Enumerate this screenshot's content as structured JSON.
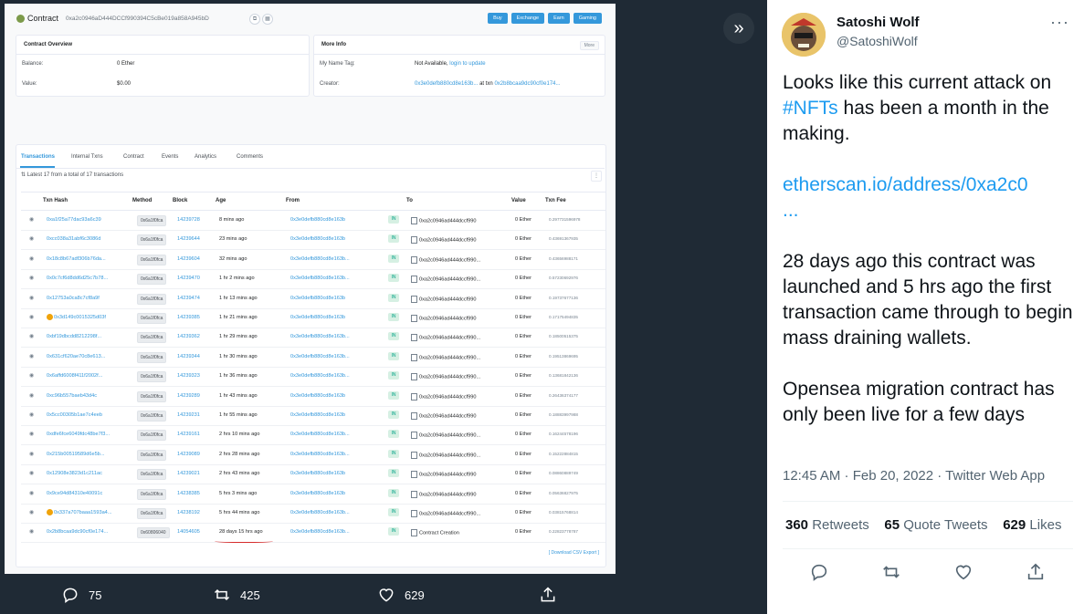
{
  "etherscan": {
    "title": "Contract",
    "address": "0xa2c0946aD444DCCf990394C5cBe019a858A945bD",
    "nav": [
      "Buy",
      "Exchange",
      "Earn",
      "Gaming"
    ],
    "overview": {
      "heading": "Contract Overview",
      "balance_label": "Balance:",
      "balance_value": "0 Ether",
      "value_label": "Value:",
      "value_value": "$0.00"
    },
    "more_info": {
      "heading": "More Info",
      "dropdown": "More",
      "tag_label": "My Name Tag:",
      "tag_value": "Not Available,",
      "tag_link": "login to update",
      "creator_label": "Creator:",
      "creator_addr": "0x3e0defb880cd8e163b...",
      "creator_at": "at txn",
      "creator_txn": "0x2b8bcaa9dc90cf0e174..."
    },
    "tabs": [
      "Transactions",
      "Internal Txns",
      "Contract",
      "Events",
      "Analytics",
      "Comments"
    ],
    "summary": "Latest 17 from a total of 17 transactions",
    "columns": [
      "Txn Hash",
      "Method",
      "Block",
      "Age",
      "From",
      "To",
      "Value",
      "Txn Fee"
    ],
    "rows": [
      {
        "hash": "0xa1f25a77dac93a6c39",
        "method": "0x6a1f0fca",
        "block": "14239728",
        "age": "8 mins ago",
        "from": "0x3e0defb880cd8e163b",
        "to": "0xa2c0946ad444dccf990",
        "value": "0 Ether",
        "fee": "0.297731596978",
        "warn": false
      },
      {
        "hash": "0xcc038a31abf6c3086d",
        "method": "0x6a1f0fca",
        "block": "14239644",
        "age": "23 mins ago",
        "from": "0x3e0defb880cd8e163b",
        "to": "0xa2c0946ad444dccf990",
        "value": "0 Ether",
        "fee": "0.43691367935",
        "warn": false
      },
      {
        "hash": "0x18c8b67adf306b76da...",
        "method": "0x6a1f0fca",
        "block": "14239604",
        "age": "32 mins ago",
        "from": "0x3e0defb880cd8e163b...",
        "to": "0xa2c0946ad444dccf990...",
        "value": "0 Ether",
        "fee": "0.43656988171",
        "warn": false
      },
      {
        "hash": "0x0c7cf6d8dd6d25c7b78...",
        "method": "0x6a1f0fca",
        "block": "14239470",
        "age": "1 hr 2 mins ago",
        "from": "0x3e0defb880cd8e163b...",
        "to": "0xa2c0946ad444dccf990...",
        "value": "0 Ether",
        "fee": "0.57230692976",
        "warn": false
      },
      {
        "hash": "0x12753a0ca8c7cf8a9f",
        "method": "0x6a1f0fca",
        "block": "14239474",
        "age": "1 hr 13 mins ago",
        "from": "0x3e0defb880cd8e163b",
        "to": "0xa2c0946ad444dccf990",
        "value": "0 Ether",
        "fee": "0.19737677136",
        "warn": false
      },
      {
        "hash": "0x3d149c0015325d03f",
        "method": "0x6a1f0fca",
        "block": "14239385",
        "age": "1 hr 21 mins ago",
        "from": "0x3e0defb880cd8e163b",
        "to": "0xa2c0946ad444dccf990",
        "value": "0 Ether",
        "fee": "0.17175494835",
        "warn": true
      },
      {
        "hash": "0xbf19dbcdd8212298f...",
        "method": "0x6a1f0fca",
        "block": "14239362",
        "age": "1 hr 29 mins ago",
        "from": "0x3e0defb880cd8e163b...",
        "to": "0xa2c0946ad444dccf990...",
        "value": "0 Ether",
        "fee": "0.18500515375",
        "warn": false
      },
      {
        "hash": "0x631cf620ae70c8e613...",
        "method": "0x6a1f0fca",
        "block": "14239344",
        "age": "1 hr 30 mins ago",
        "from": "0x3e0defb880cd8e163b...",
        "to": "0xa2c0946ad444dccf990...",
        "value": "0 Ether",
        "fee": "0.19513869695",
        "warn": false
      },
      {
        "hash": "0x6affd6008f411f2002f...",
        "method": "0x6a1f0fca",
        "block": "14239323",
        "age": "1 hr 36 mins ago",
        "from": "0x3e0defb880cd8e163b...",
        "to": "0xa2c0946ad444dccf990...",
        "value": "0 Ether",
        "fee": "0.13681842136",
        "warn": false
      },
      {
        "hash": "0xc96b557baeb43d4c",
        "method": "0x6a1f0fca",
        "block": "14239289",
        "age": "1 hr 43 mins ago",
        "from": "0x3e0defb880cd8e163b",
        "to": "0xa2c0946ad444dccf990",
        "value": "0 Ether",
        "fee": "0.26436374177",
        "warn": false
      },
      {
        "hash": "0x5cc00305b1ae7c4eeb",
        "method": "0x6a1f0fca",
        "block": "14239231",
        "age": "1 hr 55 mins ago",
        "from": "0x3e0defb880cd8e163b",
        "to": "0xa2c0946ad444dccf990",
        "value": "0 Ether",
        "fee": "0.18883997988",
        "warn": false
      },
      {
        "hash": "0xdfe6fce6049fdc48be7f3...",
        "method": "0x6a1f0fca",
        "block": "14239161",
        "age": "2 hrs 10 mins ago",
        "from": "0x3e0defb880cd8e163b...",
        "to": "0xa2c0946ad444dccf990...",
        "value": "0 Ether",
        "fee": "0.16244578196",
        "warn": false
      },
      {
        "hash": "0x215b00519589d6e5b...",
        "method": "0x6a1f0fca",
        "block": "14239089",
        "age": "2 hrs 28 mins ago",
        "from": "0x3e0defb880cd8e163b...",
        "to": "0xa2c0946ad444dccf990...",
        "value": "0 Ether",
        "fee": "0.15222884815",
        "warn": false
      },
      {
        "hash": "0x12908e3823d1c211ac",
        "method": "0x6a1f0fca",
        "block": "14239021",
        "age": "2 hrs 43 mins ago",
        "from": "0x3e0defb880cd8e163b",
        "to": "0xa2c0946ad444dccf990",
        "value": "0 Ether",
        "fee": "0.08860889749",
        "warn": false
      },
      {
        "hash": "0x9ce94d84310e40091c",
        "method": "0x6a1f0fca",
        "block": "14238385",
        "age": "5 hrs 3 mins ago",
        "from": "0x3e0defb880cd8e163b",
        "to": "0xa2c0946ad444dccf990",
        "value": "0 Ether",
        "fee": "0.05636827975",
        "warn": false
      },
      {
        "hash": "0x337a707baaa1593a4...",
        "method": "0x6a1f0fca",
        "block": "14238192",
        "age": "5 hrs 44 mins ago",
        "from": "0x3e0defb880cd8e163b...",
        "to": "0xa2c0946ad444dccf990...",
        "value": "0 Ether",
        "fee": "0.03815768814",
        "warn": true
      },
      {
        "hash": "0x2b8bcaa9dc90cf0e174...",
        "method": "0x60806040",
        "block": "14054605",
        "age": "28 days 15 hrs ago",
        "from": "0x3e0defb880cd8e163b...",
        "to": "Contract Creation",
        "value": "0 Ether",
        "fee": "0.22823778787",
        "warn": false
      }
    ],
    "csv": "[ Download CSV Export ]"
  },
  "actions": {
    "replies": "75",
    "retweets": "425",
    "likes": "629"
  },
  "tweet": {
    "name": "Satoshi Wolf",
    "handle": "@SatoshiWolf",
    "p1a": "Looks like this current attack on ",
    "hashtag": "#NFTs",
    "p1b": " has been a month in the making.",
    "link": "etherscan.io/address/0xa2c0",
    "ellipsis": "...",
    "p2": "28 days ago this contract was launched and 5 hrs ago the first transaction came through to begin mass draining wallets.",
    "p3": "Opensea migration contract has only been live for a few days",
    "timestamp": "12:45 AM · Feb 20, 2022 · Twitter Web App",
    "retweets_n": "360",
    "retweets_l": "Retweets",
    "quotes_n": "65",
    "quotes_l": "Quote Tweets",
    "likes_n": "629",
    "likes_l": "Likes"
  },
  "colors": {
    "accent": "#3498db",
    "twitter_blue": "#1d9bf0",
    "bg_dark": "#15202b"
  }
}
